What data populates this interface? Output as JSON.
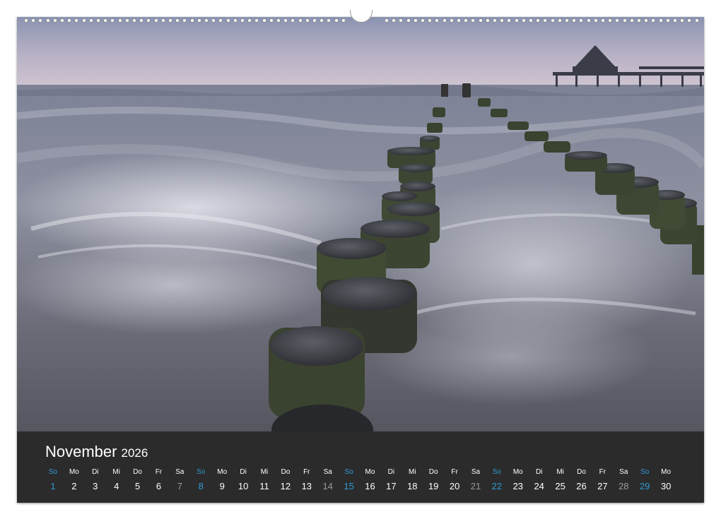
{
  "calendar": {
    "month": "November",
    "year": "2026",
    "weekday_labels": [
      "So",
      "Mo",
      "Di",
      "Mi",
      "Do",
      "Fr",
      "Sa",
      "So",
      "Mo",
      "Di",
      "Mi",
      "Do",
      "Fr",
      "Sa",
      "So",
      "Mo",
      "Di",
      "Mi",
      "Do",
      "Fr",
      "Sa",
      "So",
      "Mo",
      "Di",
      "Mi",
      "Do",
      "Fr",
      "Sa",
      "So",
      "Mo"
    ],
    "days": [
      "1",
      "2",
      "3",
      "4",
      "5",
      "6",
      "7",
      "8",
      "9",
      "10",
      "11",
      "12",
      "13",
      "14",
      "15",
      "16",
      "17",
      "18",
      "19",
      "20",
      "21",
      "22",
      "23",
      "24",
      "25",
      "26",
      "27",
      "28",
      "29",
      "30"
    ],
    "sunday_color": "#2f9bd6",
    "saturday_color": "#9a9a9a",
    "weekday_color": "#ffffff",
    "bar_color": "#2b2b2b"
  },
  "photo": {
    "subject_icons": [
      "sea-icon",
      "groyne-icon",
      "pier-icon"
    ]
  }
}
